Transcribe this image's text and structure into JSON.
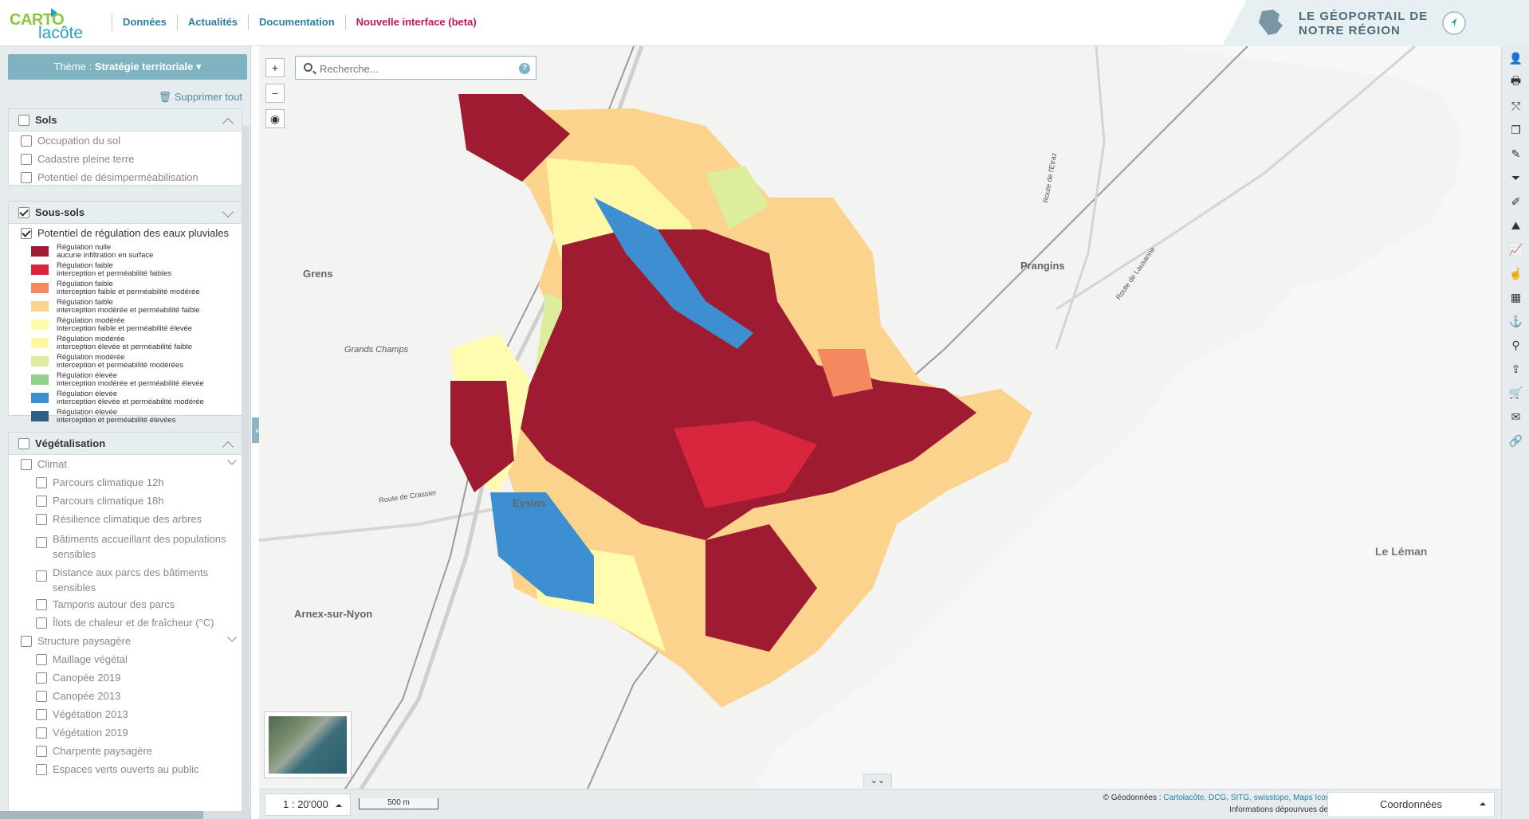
{
  "header": {
    "logo_line1": "CARTO",
    "logo_line2": "lacôte",
    "nav": [
      "Données",
      "Actualités",
      "Documentation",
      "Nouvelle interface (beta)"
    ],
    "geoportail_line1": "LE GÉOPORTAIL DE",
    "geoportail_line2": "NOTRE RÉGION"
  },
  "left_panel": {
    "theme_prefix": "Thème : ",
    "theme_value": "Stratégie territoriale",
    "clear_all": "Supprimer tout",
    "sols": {
      "title": "Sols",
      "items": [
        "Occupation du sol",
        "Cadastre pleine terre",
        "Potentiel de désimperméabilisation"
      ]
    },
    "soussols": {
      "title": "Sous-sols",
      "layer": "Potentiel de régulation des eaux pluviales",
      "legend": [
        {
          "color": "#9e1b32",
          "l1": "Régulation nulle",
          "l2": "aucune infiltration en surface"
        },
        {
          "color": "#d7263d",
          "l1": "Régulation faible",
          "l2": "interception et perméabilité faibles"
        },
        {
          "color": "#f4895f",
          "l1": "Régulation faible",
          "l2": "interception faible et perméabilité modérée"
        },
        {
          "color": "#fbd38d",
          "l1": "Régulation faible",
          "l2": "interception modérée et perméabilité faible"
        },
        {
          "color": "#fffcb0",
          "l1": "Régulation modérée",
          "l2": "interception faible et perméabilité élevée"
        },
        {
          "color": "#fdf7a6",
          "l1": "Régulation modérée",
          "l2": "interception élevée et perméabilité faible"
        },
        {
          "color": "#dcee9c",
          "l1": "Régulation modérée",
          "l2": "interception et perméabilité modérées"
        },
        {
          "color": "#90d18c",
          "l1": "Régulation élevée",
          "l2": "interception modérée et perméabilité élevée"
        },
        {
          "color": "#3d8fd1",
          "l1": "Régulation élevée",
          "l2": "interception élevée et perméabilité modérée"
        },
        {
          "color": "#2d5f86",
          "l1": "Régulation élevée",
          "l2": "interception et perméabilité élevées"
        }
      ]
    },
    "vegetalisation": {
      "title": "Végétalisation",
      "climat": "Climat",
      "climat_items": [
        "Parcours climatique 12h",
        "Parcours climatique 18h",
        "Résilience climatique des arbres"
      ],
      "climat_two_line": [
        {
          "l1": "Bâtiments accueillant des populations",
          "l2": "sensibles"
        },
        {
          "l1": "Distance aux parcs des bâtiments",
          "l2": "sensibles"
        }
      ],
      "climat_items2": [
        "Tampons autour des parcs",
        "Îlots de chaleur et de fraîcheur (°C)"
      ],
      "structure": "Structure paysagère",
      "structure_items": [
        "Maillage végétal",
        "Canopée 2019",
        "Canopée 2013",
        "Végétation 2013",
        "Végétation 2019",
        "Charpente paysagère",
        "Espaces verts ouverts au public"
      ]
    }
  },
  "search": {
    "placeholder": "Recherche..."
  },
  "map": {
    "places": [
      "Grens",
      "Prangins",
      "Eysins",
      "Arnex-sur-Nyon",
      "Le Léman"
    ],
    "small_places": [
      "Grands Champs"
    ],
    "roads": [
      "Route de Crassier",
      "Route de l'Etraz",
      "Route de Lausanne"
    ]
  },
  "bottom": {
    "scale": "1 : 20'000",
    "scalebar": "500 m",
    "credits_prefix": "© Géodonnées : ",
    "credits_links": "Cartolacôte, DCG, SITG, swisstopo, Maps Icons Collection",
    "credits_line2": "Informations dépourvues de foi publique",
    "coords": "Coordonnées"
  },
  "colors": {
    "accent": "#7fb3c1",
    "nav": "#2c7fa3",
    "beta": "#c2185b",
    "regulation_nulle": "#9e1b32"
  }
}
